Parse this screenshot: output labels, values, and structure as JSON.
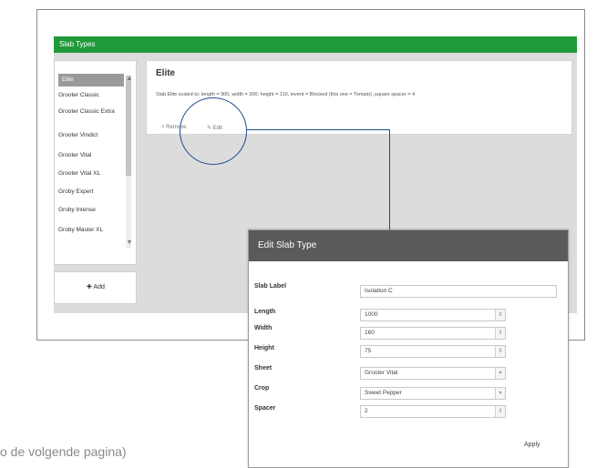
{
  "app": {
    "title": "Slab Types"
  },
  "sidebar": {
    "items": [
      {
        "label": "Elite"
      },
      {
        "label": "Grooter Classic"
      },
      {
        "label": "Grooter Classic Extra"
      },
      {
        "label": "Grooter Vindict"
      },
      {
        "label": "Grooter Vital"
      },
      {
        "label": "Grooter Vital XL"
      },
      {
        "label": "Groby Expert"
      },
      {
        "label": "Groby Intense"
      },
      {
        "label": "Groby Master XL"
      }
    ],
    "add_label": "✚ Add"
  },
  "detail": {
    "title": "Elite",
    "description": "Slab Elite scaled to: length = 900, width = 300, height = 110, invent = Blocked (this one = Tomato) ,square spacer = 4",
    "remove_label": "× Remove",
    "edit_label": "✎ Edit"
  },
  "dialog": {
    "title": "Edit Slab Type",
    "fields": [
      {
        "label": "Slab Label",
        "value": "Isolation C"
      },
      {
        "label": "Length",
        "value": "1000"
      },
      {
        "label": "Width",
        "value": "160"
      },
      {
        "label": "Height",
        "value": "75"
      },
      {
        "label": "Sheet",
        "value": "Grooter Vital"
      },
      {
        "label": "Crop",
        "value": "Sweet Pepper"
      },
      {
        "label": "Spacer",
        "value": "2"
      }
    ],
    "apply_label": "Apply"
  },
  "footnote": "o de volgende pagina)",
  "colors": {
    "accent": "#1f9a3a",
    "callout": "#1e4a8c",
    "dialog_header": "#5a5a5a"
  }
}
